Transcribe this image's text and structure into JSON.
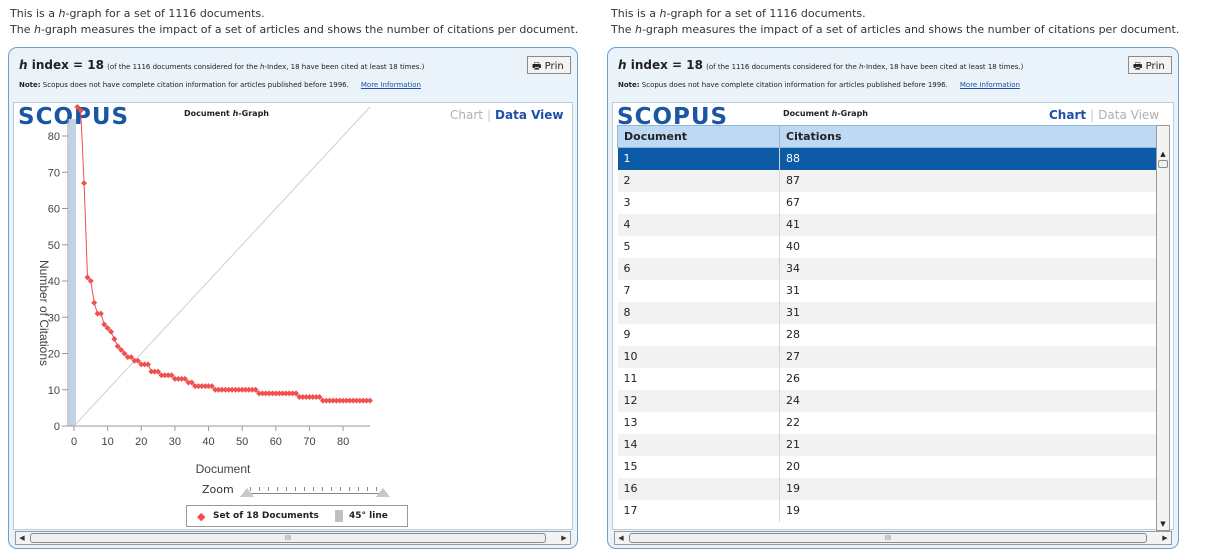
{
  "intro_left": {
    "line1_pre": "This is a ",
    "h": "h",
    "line1_post": "-graph for a set of 1116 documents.",
    "line2_pre": "The ",
    "line2_post": "-graph measures the impact of a set of articles and shows the number of citations per document."
  },
  "intro_right": {
    "line1_pre": "This is a ",
    "h": "h",
    "line1_post": "-graph for a set of 1116 documents.",
    "line2_pre": "The ",
    "line2_post": "-graph measures the impact of a set of articles and shows the number of citations per document."
  },
  "hindex": {
    "h": "h",
    "label": " index = ",
    "value": "18",
    "detail_pre": "(of the 1116 documents considered for the ",
    "detail_post": "-Index, 18 have been cited at least 18 times.)",
    "print_label": "Prin"
  },
  "note": {
    "bold": "Note:",
    "text": " Scopus does not have complete citation information for articles published before 1996.",
    "link": "More Information"
  },
  "logo": "SCOPUS",
  "logo_sub_pre": "Document ",
  "logo_sub_h": "h",
  "logo_sub_post": "-Graph",
  "view_switch": {
    "chart": "Chart",
    "separator": "|",
    "data": "Data View"
  },
  "zoom_label": "Zoom",
  "legend": {
    "series": "Set of 18 Documents",
    "line": "45° line"
  },
  "colors": {
    "series": "#f05050",
    "accent": "#1f4fa8",
    "selected_row": "#0a5aa6",
    "h_bar": "#bfd2e6"
  },
  "chart_data": {
    "type": "scatter",
    "xlabel": "Document",
    "ylabel": "Number of Citations",
    "xlim": [
      0,
      88
    ],
    "ylim": [
      0,
      88
    ],
    "xticks": [
      0,
      10,
      20,
      30,
      40,
      50,
      60,
      70,
      80
    ],
    "yticks": [
      0,
      10,
      20,
      30,
      40,
      50,
      60,
      70,
      80
    ],
    "reference_line": "45° line",
    "h_index": 18,
    "series": [
      {
        "name": "Set of 18 Documents",
        "x": [
          1,
          2,
          3,
          4,
          5,
          6,
          7,
          8,
          9,
          10,
          11,
          12,
          13,
          14,
          15,
          16,
          17,
          18,
          19,
          20,
          21,
          22,
          23,
          24,
          25,
          26,
          27,
          28,
          29,
          30,
          31,
          32,
          33,
          34,
          35,
          36,
          37,
          38,
          39,
          40,
          41,
          42,
          43,
          44,
          45,
          46,
          47,
          48,
          49,
          50,
          51,
          52,
          53,
          54,
          55,
          56,
          57,
          58,
          59,
          60,
          61,
          62,
          63,
          64,
          65,
          66,
          67,
          68,
          69,
          70,
          71,
          72,
          73,
          74,
          75,
          76,
          77,
          78,
          79,
          80,
          81,
          82,
          83,
          84,
          85,
          86,
          87,
          88
        ],
        "y": [
          88,
          87,
          67,
          41,
          40,
          34,
          31,
          31,
          28,
          27,
          26,
          24,
          22,
          21,
          20,
          19,
          19,
          18,
          18,
          17,
          17,
          17,
          15,
          15,
          15,
          14,
          14,
          14,
          14,
          13,
          13,
          13,
          13,
          12,
          12,
          11,
          11,
          11,
          11,
          11,
          11,
          10,
          10,
          10,
          10,
          10,
          10,
          10,
          10,
          10,
          10,
          10,
          10,
          10,
          9,
          9,
          9,
          9,
          9,
          9,
          9,
          9,
          9,
          9,
          9,
          9,
          8,
          8,
          8,
          8,
          8,
          8,
          8,
          7,
          7,
          7,
          7,
          7,
          7,
          7,
          7,
          7,
          7,
          7,
          7,
          7,
          7,
          7
        ]
      }
    ]
  },
  "table": {
    "headers": [
      "Document",
      "Citations"
    ],
    "rows": [
      [
        "1",
        "88"
      ],
      [
        "2",
        "87"
      ],
      [
        "3",
        "67"
      ],
      [
        "4",
        "41"
      ],
      [
        "5",
        "40"
      ],
      [
        "6",
        "34"
      ],
      [
        "7",
        "31"
      ],
      [
        "8",
        "31"
      ],
      [
        "9",
        "28"
      ],
      [
        "10",
        "27"
      ],
      [
        "11",
        "26"
      ],
      [
        "12",
        "24"
      ],
      [
        "13",
        "22"
      ],
      [
        "14",
        "21"
      ],
      [
        "15",
        "20"
      ],
      [
        "16",
        "19"
      ],
      [
        "17",
        "19"
      ]
    ]
  },
  "scrollbar_grip": "III"
}
